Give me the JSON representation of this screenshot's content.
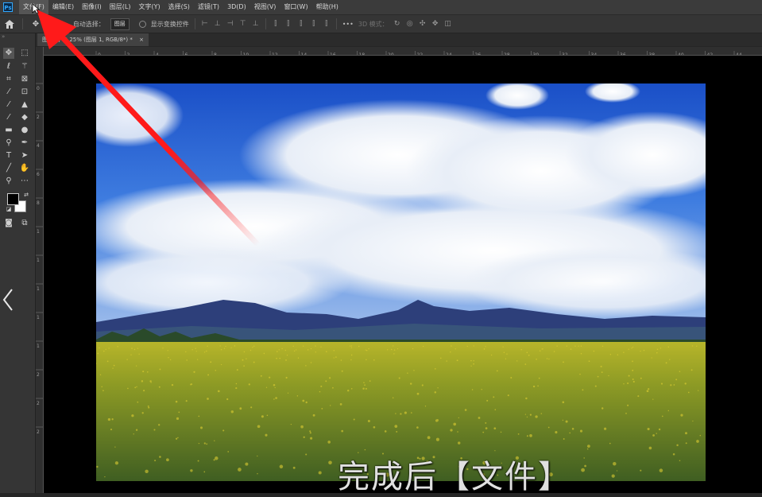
{
  "app": {
    "logo_text": "Ps"
  },
  "menubar": {
    "items": [
      "文件(F)",
      "编辑(E)",
      "图像(I)",
      "图层(L)",
      "文字(Y)",
      "选择(S)",
      "滤镜(T)",
      "3D(D)",
      "视图(V)",
      "窗口(W)",
      "帮助(H)"
    ]
  },
  "options_bar": {
    "auto_select_label": "自动选择：",
    "auto_select_value": "图层",
    "show_transform_label": "显示变换控件",
    "three_d_label": "3D 模式："
  },
  "document": {
    "tab_title": "图层 1, @ 25% (图层 1, RGB/8*) *",
    "close_glyph": "×"
  },
  "ruler": {
    "top_ticks": [
      "0",
      "2",
      "4",
      "6",
      "8",
      "10",
      "12",
      "14",
      "16",
      "18",
      "20",
      "22",
      "24",
      "26",
      "28",
      "30",
      "32",
      "34",
      "36",
      "38",
      "40",
      "42",
      "44"
    ],
    "left_ticks": [
      "0",
      "2",
      "4",
      "6",
      "8",
      "1",
      "1",
      "1",
      "1",
      "1",
      "2",
      "2",
      "2"
    ]
  },
  "caption": {
    "text": "完成后【文件】"
  },
  "icons": {
    "home": "home-icon",
    "move": "move-icon",
    "collapse": "chevron-left-icon"
  },
  "colors": {
    "arrow": "#ff1a1a",
    "ps_blue": "#31a8ff"
  }
}
